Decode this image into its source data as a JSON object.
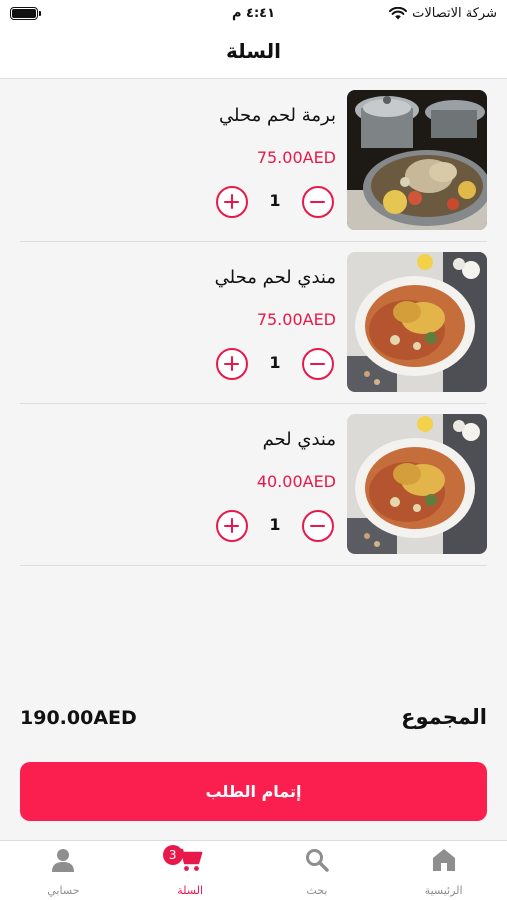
{
  "status_bar": {
    "time": "٤:٤١ م",
    "carrier": "شركة الاتصالات"
  },
  "header": {
    "title": "السلة"
  },
  "cart": {
    "items": [
      {
        "name": "برمة لحم محلي",
        "price": "75.00AED",
        "quantity": "1",
        "image": "pot-with-meat-and-potatoes"
      },
      {
        "name": "مندي لحم محلي",
        "price": "75.00AED",
        "quantity": "1",
        "image": "mandi-rice-plate"
      },
      {
        "name": "مندي لحم",
        "price": "40.00AED",
        "quantity": "1",
        "image": "mandi-rice-plate"
      }
    ]
  },
  "summary": {
    "total_label": "المجموع",
    "total_value": "190.00AED"
  },
  "checkout": {
    "label": "إتمام الطلب"
  },
  "bottom_nav": {
    "items": [
      {
        "label": "الرئيسية",
        "icon": "home-icon"
      },
      {
        "label": "بحث",
        "icon": "search-icon"
      },
      {
        "label": "السلة",
        "icon": "cart-icon",
        "badge": "3",
        "active": true
      },
      {
        "label": "حسابي",
        "icon": "person-icon"
      }
    ]
  },
  "colors": {
    "accent": "#e8194a",
    "checkout_bg": "#fb1f4f",
    "background": "#f5f5f5"
  }
}
